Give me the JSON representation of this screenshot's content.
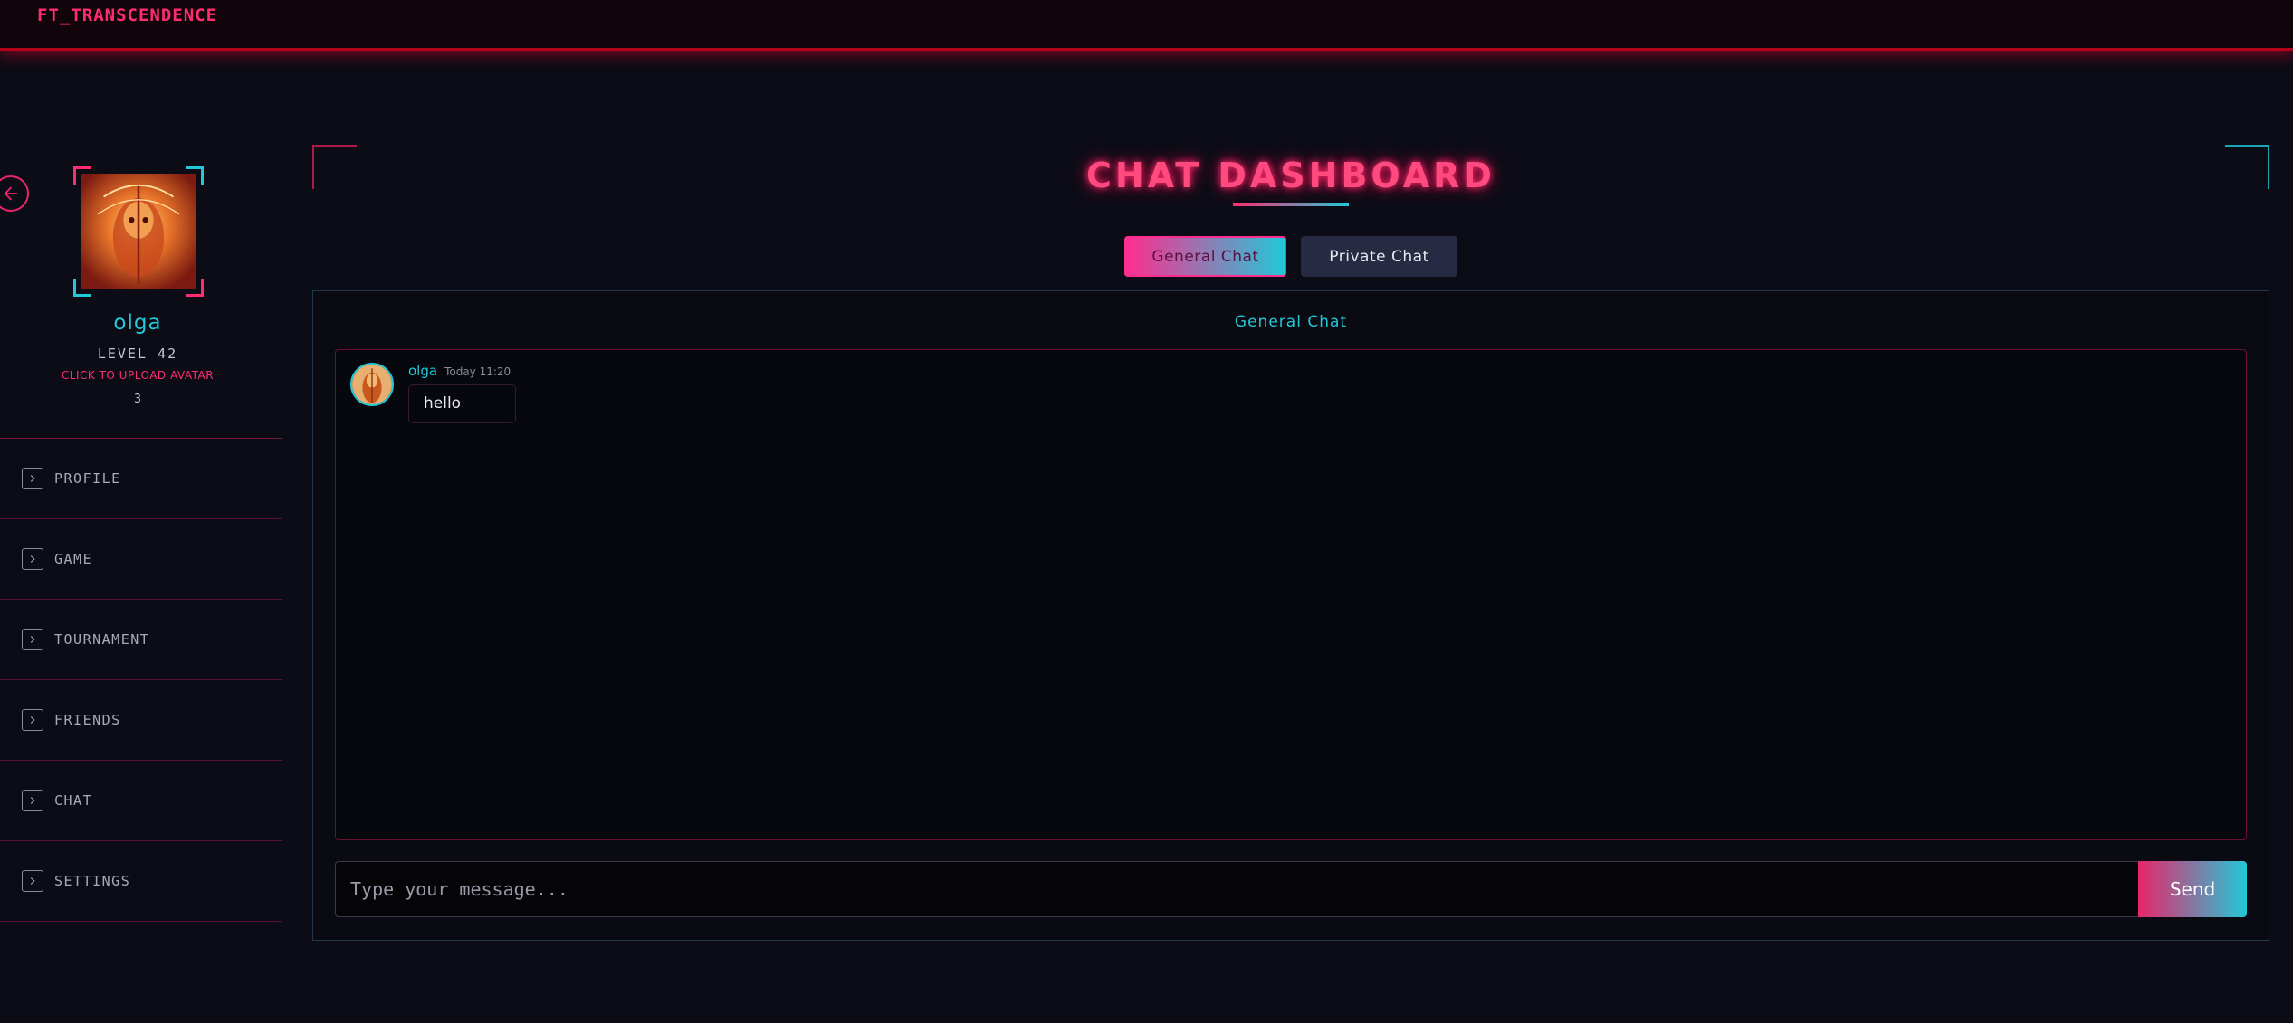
{
  "app": {
    "brand": "FT_TRANSCENDENCE"
  },
  "profile": {
    "username": "olga",
    "level": "LEVEL 42",
    "upload_label": "CLICK TO UPLOAD AVATAR",
    "count": "3"
  },
  "menu": {
    "items": [
      {
        "label": "PROFILE"
      },
      {
        "label": "GAME"
      },
      {
        "label": "TOURNAMENT"
      },
      {
        "label": "FRIENDS"
      },
      {
        "label": "CHAT"
      },
      {
        "label": "SETTINGS"
      }
    ]
  },
  "chat": {
    "title": "CHAT DASHBOARD",
    "tabs": [
      {
        "label": "General Chat",
        "active": true
      },
      {
        "label": "Private Chat",
        "active": false
      }
    ],
    "panel_title": "General Chat",
    "messages": [
      {
        "user": "olga",
        "time": "Today 11:20",
        "text": "hello"
      }
    ],
    "input_placeholder": "Type your message...",
    "send_label": "Send"
  },
  "colors": {
    "accent_pink": "#ff2d6f",
    "accent_cyan": "#22c8d8",
    "topbar_red": "#b3001b",
    "background": "#0c0c16"
  },
  "icons": {
    "back": "arrow-left-icon",
    "menu_chevron": "chevron-right-icon"
  }
}
